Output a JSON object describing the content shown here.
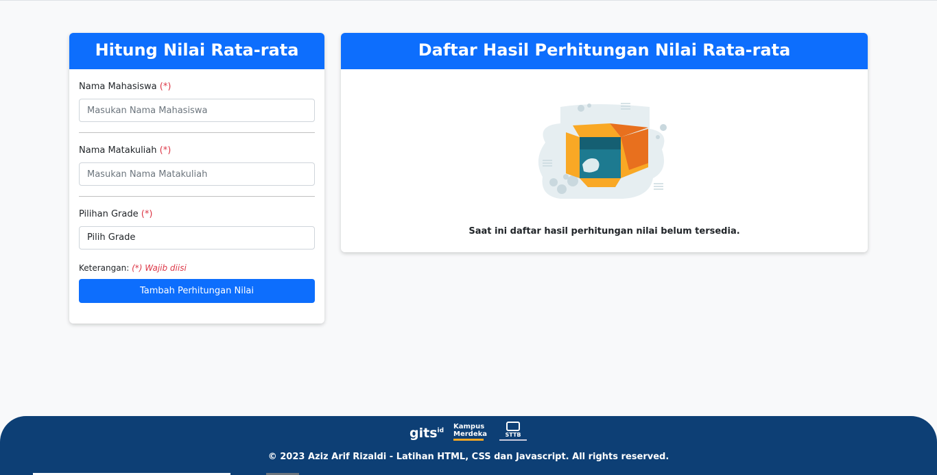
{
  "form": {
    "title": "Hitung Nilai Rata-rata",
    "name_label": "Nama Mahasiswa",
    "name_placeholder": "Masukan Nama Mahasiswa",
    "course_label": "Nama Matakuliah",
    "course_placeholder": "Masukan Nama Matakuliah",
    "grade_label": "Pilihan Grade",
    "grade_selected": "Pilih Grade",
    "required_marker": "(*)",
    "note_label": "Keterangan:",
    "note_text": "(*) Wajib diisi",
    "submit_label": "Tambah Perhitungan Nilai"
  },
  "results": {
    "title": "Daftar Hasil Perhitungan Nilai Rata-rata",
    "empty_message": "Saat ini daftar hasil perhitungan nilai belum tersedia.",
    "illustration_icon": "empty-box-icon"
  },
  "footer": {
    "copyright": "© 2023 Aziz Arif Rizaldi - Latihan HTML, CSS dan Javascript. All rights reserved.",
    "logo_gits": "gits",
    "logo_gits_suffix": "id",
    "logo_kampus": "Kampus",
    "logo_merdeka": "Merdeka",
    "logo_sttb": "STTB"
  },
  "colors": {
    "primary": "#0d6efd",
    "required": "#dc3545",
    "footer_bg": "#0d3f75"
  }
}
